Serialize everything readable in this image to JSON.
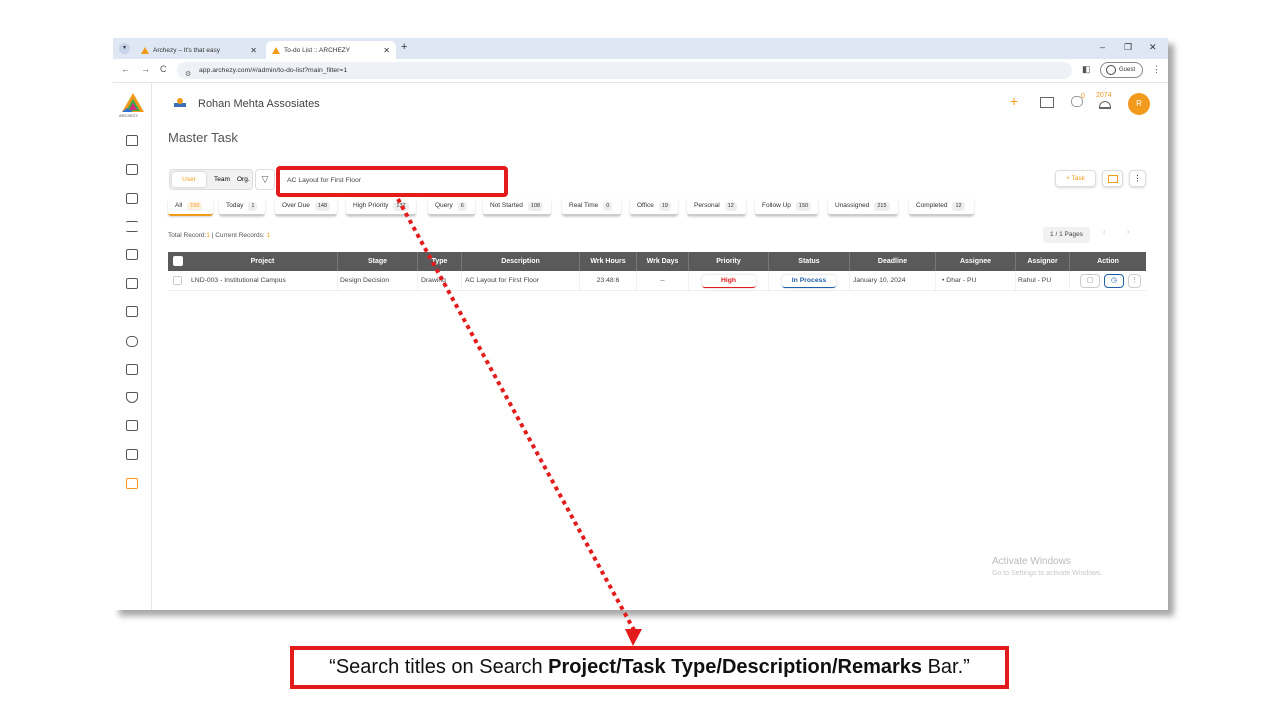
{
  "browser": {
    "tabs": [
      {
        "title": "Archezy – It's that easy",
        "active": false
      },
      {
        "title": "To-do List :: ARCHEZY",
        "active": true
      }
    ],
    "url": "app.archezy.com/#/admin/to-do-list?main_filter=1",
    "profile_label": "Guest",
    "window_controls": {
      "minimize": "–",
      "restore": "❐",
      "close": "✕"
    },
    "nav": {
      "back": "←",
      "forward": "→",
      "reload": "C"
    }
  },
  "app": {
    "brand_label": "ARCHEZY",
    "company_name": "Rohan Mehta Assosiates",
    "header": {
      "add_icon": "+",
      "chat_count": "0",
      "notification_count": "2074",
      "avatar_letter": "R"
    },
    "page_title": "Master Task",
    "toggle": {
      "options": [
        "User",
        "Team",
        "Org."
      ],
      "selected": "User"
    },
    "search": {
      "value": "AC Layout for First Floor",
      "placeholder": "Search Project/Task Type/Description/Remarks"
    },
    "task_button_label": "+ Task",
    "filters": [
      {
        "label": "All",
        "count": "150",
        "active": true
      },
      {
        "label": "Today",
        "count": "1"
      },
      {
        "label": "Over Due",
        "count": "148"
      },
      {
        "label": "High Priority",
        "count": "132"
      },
      {
        "label": "Query",
        "count": "6"
      },
      {
        "label": "Not Started",
        "count": "108"
      },
      {
        "label": "Real Time",
        "count": "0"
      },
      {
        "label": "Office",
        "count": "19"
      },
      {
        "label": "Personal",
        "count": "12"
      },
      {
        "label": "Follow Up",
        "count": "150"
      },
      {
        "label": "Unassigned",
        "count": "215"
      },
      {
        "label": "Completed",
        "count": "12"
      }
    ],
    "records": {
      "total_label": "Total Record:",
      "total": "1",
      "separator": " | ",
      "current_label": "Current Records: ",
      "current": "1"
    },
    "pagination": {
      "label": "1 / 1 Pages",
      "prev": "‹",
      "next": "›"
    },
    "table": {
      "columns": [
        "Project",
        "Stage",
        "Type",
        "Description",
        "Wrk Hours",
        "Wrk Days",
        "Priority",
        "Status",
        "Deadline",
        "Assignee",
        "Assignor",
        "Action"
      ],
      "rows": [
        {
          "project": "LND-003 - Institutional Campus",
          "stage": "Design Decision",
          "type": "Drawing",
          "description": "AC Layout for First Floor",
          "wrk_hours": "23:48:6",
          "wrk_days": "--",
          "priority": "High",
          "status": "In Process",
          "deadline": "January 10, 2024",
          "assignee": "Dhar - PU",
          "assignor": "Rahul - PU"
        }
      ]
    },
    "watermark": {
      "title": "Activate Windows",
      "subtitle": "Go to Settings to activate Windows."
    },
    "colors": {
      "accent": "#f29a1c",
      "danger": "#e31b1b",
      "info": "#1f5fa8",
      "table_header": "#5a5a5a"
    }
  },
  "callout": {
    "open_quote": "“",
    "prefix": "Search titles on Search ",
    "bold": "Project/Task Type/Description/Remarks",
    "suffix": " Bar.”",
    "border_color": "#e31b1b"
  }
}
